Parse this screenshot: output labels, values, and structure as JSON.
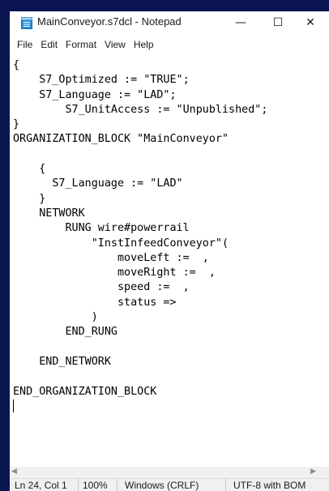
{
  "window": {
    "title": "MainConveyor.s7dcl - Notepad",
    "minimize_glyph": "—",
    "maximize_glyph": "☐",
    "close_glyph": "✕"
  },
  "menu": [
    "File",
    "Edit",
    "Format",
    "View",
    "Help"
  ],
  "editor": {
    "lines": [
      "{",
      "    S7_Optimized := \"TRUE\";",
      "    S7_Language := \"LAD\";",
      "        S7_UnitAccess := \"Unpublished\";",
      "}",
      "ORGANIZATION_BLOCK \"MainConveyor\"",
      "",
      "    {",
      "      S7_Language := \"LAD\"",
      "    }",
      "    NETWORK",
      "        RUNG wire#powerrail",
      "            \"InstInfeedConveyor\"(",
      "                moveLeft :=  ,",
      "                moveRight :=  ,",
      "                speed :=  ,",
      "                status =>",
      "            )",
      "        END_RUNG",
      "",
      "    END_NETWORK",
      "",
      "END_ORGANIZATION_BLOCK",
      ""
    ]
  },
  "status": {
    "position": "Ln 24, Col 1",
    "zoom": "100%",
    "line_ending": "Windows (CRLF)",
    "encoding": "UTF-8 with BOM"
  },
  "scroll": {
    "left_glyph": "◀",
    "right_glyph": "▶"
  },
  "colors": {
    "desktop": "#0a1450",
    "window_bg": "#ffffff",
    "statusbar_bg": "#f0f0f0"
  }
}
